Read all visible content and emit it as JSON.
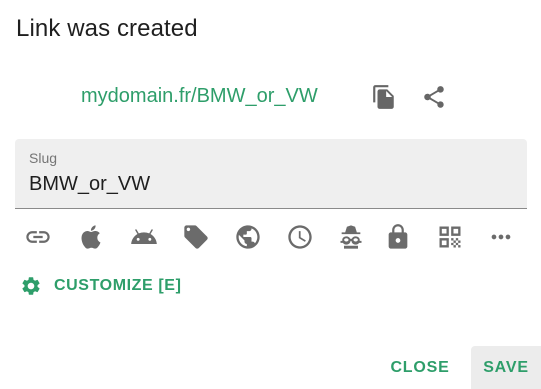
{
  "dialog": {
    "title": "Link was created",
    "short_link": "mydomain.fr/BMW_or_VW",
    "link_actions": [
      {
        "name": "copy-icon"
      },
      {
        "name": "share-icon"
      }
    ],
    "slug": {
      "label": "Slug",
      "value": "BMW_or_VW"
    },
    "option_icons": [
      "link-icon",
      "apple-icon",
      "android-icon",
      "tag-icon",
      "globe-icon",
      "clock-icon",
      "incognito-icon",
      "lock-icon",
      "qr-code-icon",
      "more-horiz-icon"
    ],
    "customize_label": "CUSTOMIZE [E]",
    "close_label": "CLOSE",
    "save_label": "SAVE"
  },
  "colors": {
    "accent": "#2e9e6a",
    "icon": "#6b6b6b",
    "field_bg": "#efefef"
  }
}
